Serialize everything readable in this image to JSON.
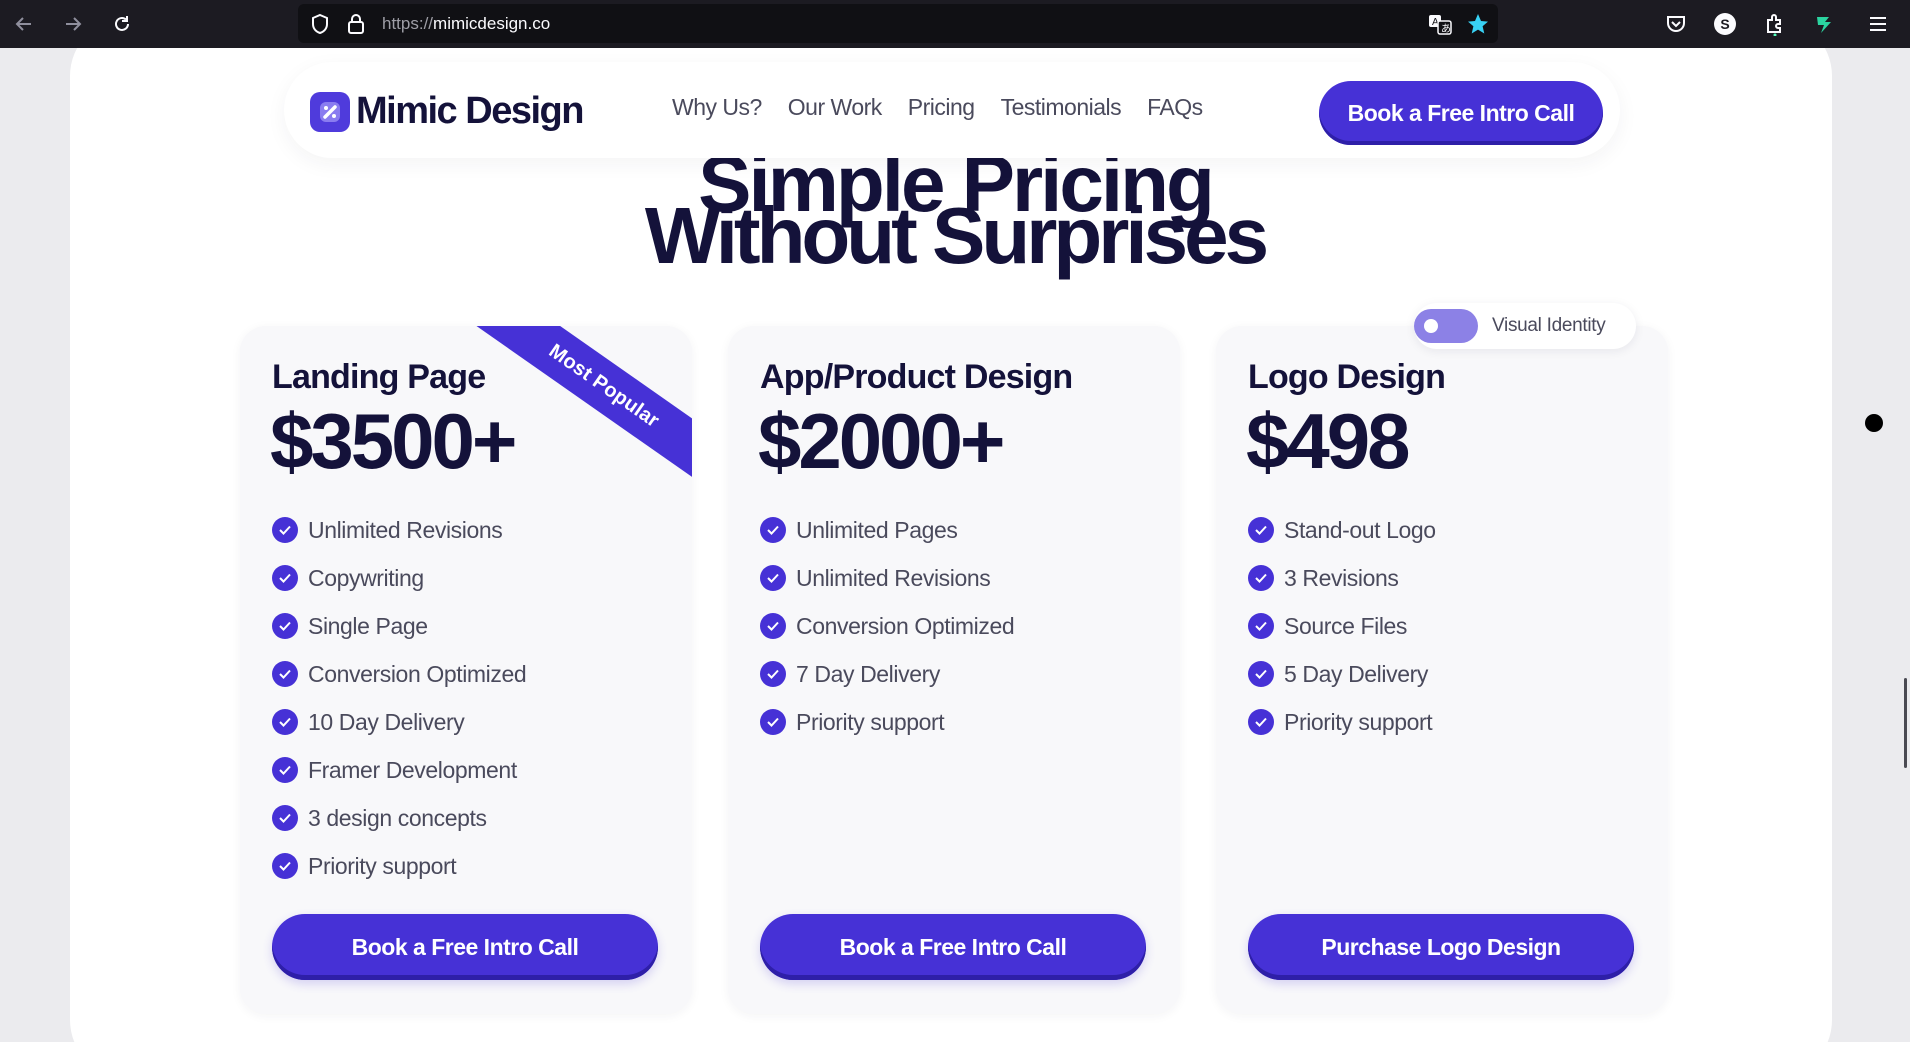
{
  "browser": {
    "url_protocol": "https://",
    "url_host": "mimicdesign.co",
    "icons": [
      "back-arrow-icon",
      "forward-arrow-icon",
      "reload-icon",
      "shield-icon",
      "lock-icon",
      "translate-icon",
      "bookmark-star-icon",
      "pocket-icon",
      "profile-icon",
      "extensions-icon",
      "extension-leaf-icon",
      "menu-icon"
    ],
    "profile_letter": "S"
  },
  "nav": {
    "logo_text": "Mimic Design",
    "links": [
      "Why Us?",
      "Our Work",
      "Pricing",
      "Testimonials",
      "FAQs"
    ],
    "cta_label": "Book a Free Intro Call"
  },
  "heading": {
    "line1_partial": "Simple Pricing",
    "line2": "Without Surprises"
  },
  "toggle": {
    "label": "Visual Identity",
    "on": false
  },
  "cards": [
    {
      "title": "Landing Page",
      "price": "$3500+",
      "ribbon": "Most Popular",
      "features": [
        "Unlimited Revisions",
        "Copywriting",
        "Single Page",
        "Conversion Optimized",
        "10 Day Delivery",
        "Framer Development",
        "3 design concepts",
        "Priority support"
      ],
      "button": "Book a Free Intro Call"
    },
    {
      "title": "App/Product Design",
      "price": "$2000+",
      "features": [
        "Unlimited Pages",
        "Unlimited Revisions",
        "Conversion Optimized",
        "7 Day Delivery",
        "Priority support"
      ],
      "button": "Book a Free Intro Call"
    },
    {
      "title": "Logo Design",
      "price": "$498",
      "features": [
        "Stand-out Logo",
        "3 Revisions",
        "Source Files",
        "5 Day Delivery",
        "Priority support"
      ],
      "button": "Purchase Logo Design"
    }
  ],
  "colors": {
    "accent": "#4631d6",
    "heading": "#14123a",
    "body_text": "#4a4a5c",
    "card_bg": "#f8f8fa"
  }
}
